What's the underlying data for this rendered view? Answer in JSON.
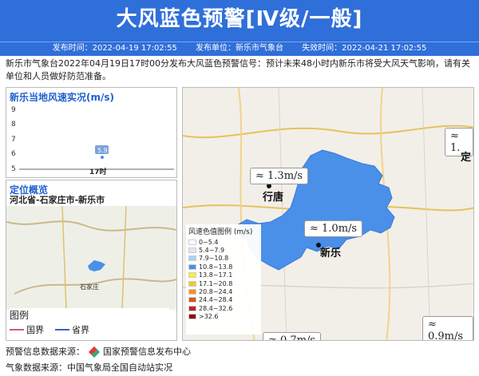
{
  "header": {
    "title": "大风蓝色预警[Ⅳ级/一般]"
  },
  "meta": {
    "publish_time": "发布时间：2022-04-19 17:02:55",
    "publisher": "发布单位：新乐市气象台",
    "expire_time": "失效时间：2022-04-21 17:02:55"
  },
  "notice": "新乐市气象台2022年04月19日17时00分发布大风蓝色预警信号：预计未来48小时内新乐市将受大风天气影响，请有关单位和人员做好防范准备。",
  "wind_panel": {
    "title": "新乐当地风速实况(m/s)",
    "y_ticks": [
      "9",
      "8",
      "7",
      "6",
      "5"
    ],
    "x_label": "17时",
    "value_label": "5.9"
  },
  "location_panel": {
    "title": "定位概览",
    "region": "河北省-石家庄市-新乐市",
    "shijiazhuang": "石家庄",
    "legend_title": "图例",
    "legend_national": "国界",
    "legend_province": "省界"
  },
  "map": {
    "cities": [
      "行唐",
      "新乐",
      "定"
    ],
    "wind_labels": [
      "1.3m/s",
      "1.0m/s",
      "0.9m/s",
      "0.7m/s",
      "1."
    ],
    "legend_title": "风速色值图例 (m/s)",
    "legend_items": [
      {
        "label": "0~5.4",
        "color": "#ffffff"
      },
      {
        "label": "5.4~7.9",
        "color": "#d8ecfa"
      },
      {
        "label": "7.9~10.8",
        "color": "#a9d4f5"
      },
      {
        "label": "10.8~13.8",
        "color": "#4a8fe8"
      },
      {
        "label": "13.8~17.1",
        "color": "#f6ef3b"
      },
      {
        "label": "17.1~20.8",
        "color": "#f5c533"
      },
      {
        "label": "20.8~24.4",
        "color": "#f08f24"
      },
      {
        "label": "24.4~28.4",
        "color": "#e2531c"
      },
      {
        "label": "28.4~32.6",
        "color": "#c81e1e"
      },
      {
        "label": ">32.6",
        "color": "#8d1010"
      }
    ]
  },
  "footer": {
    "source1_prefix": "预警信息数据来源：",
    "source1_name": "国家预警信息发布中心",
    "source2": "气象数据来源：中国气象局全国自动站实况"
  },
  "colors": {
    "header": "#2f6fd9",
    "accent": "#1f5fcf",
    "warning_area": "#4a8fe8"
  }
}
